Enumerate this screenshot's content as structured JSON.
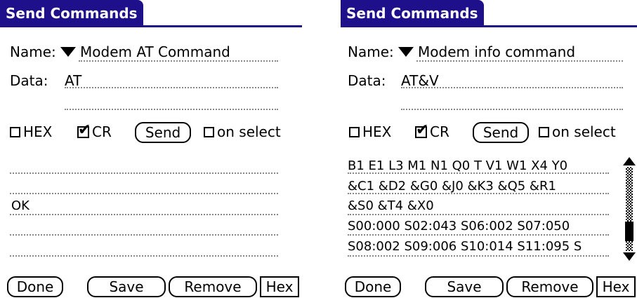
{
  "left": {
    "title": "Send Commands",
    "name_label": "Name:",
    "name_value": "Modem AT Command",
    "data_label": "Data:",
    "data_value": "AT",
    "hex_checkbox": "HEX",
    "cr_checkbox": "CR",
    "send_button": "Send",
    "on_select_checkbox": "on select",
    "output_lines": [
      "",
      "",
      "OK",
      "",
      ""
    ],
    "done_button": "Done",
    "save_button": "Save",
    "remove_button": "Remove",
    "hex_button": "Hex"
  },
  "right": {
    "title": "Send Commands",
    "name_label": "Name:",
    "name_value": "Modem info command",
    "data_label": "Data:",
    "data_value": "AT&V",
    "hex_checkbox": "HEX",
    "cr_checkbox": "CR",
    "send_button": "Send",
    "on_select_checkbox": "on select",
    "output_lines": [
      "B1 E1 L3 M1 N1 Q0 T V1 W1 X4 Y0",
      "&C1 &D2 &G0 &J0 &K3 &Q5 &R1",
      "&S0 &T4 &X0",
      "S00:000 S02:043 S06:002 S07:050",
      "S08:002 S09:006 S10:014 S11:095 S"
    ],
    "done_button": "Done",
    "save_button": "Save",
    "remove_button": "Remove",
    "hex_button": "Hex",
    "scroll_position": 0.85
  },
  "hex_checked": false,
  "cr_checked": true,
  "on_select_checked": false,
  "accent_color": "#1e0f8a"
}
